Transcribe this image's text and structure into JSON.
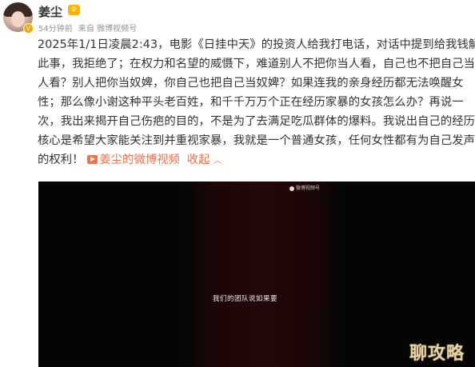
{
  "user": {
    "name": "姜尘",
    "vip_badge": "♔",
    "verified_mark": "V"
  },
  "meta": {
    "time": "54分钟前",
    "source": "来自 微博视频号"
  },
  "post": {
    "lines": [
      "2025年1/1日凌晨2:43，电影《日挂中天》的投资人给我打电话，对话中提到给我钱解决",
      "此事，我拒绝了；在权力和名望的威慑下，难道别人不把你当人看，自己也不把自己当",
      "人看？别人把你当奴婢，你自己也把自己当奴婢？如果连我的亲身经历都无法唤醒女",
      "性；那么像小谢这种平头老百姓，和千千万万个正在经历家暴的女孩怎么办？再说一",
      "次，我出来揭开自己伤疤的目的，不是为了去满足吃瓜群体的爆料。我说出自己的经历",
      "核心是希望大家能关注到并重视家暴，我就是一个普通女孩，任何女性都有为自己发声"
    ],
    "last_line_start": "的权利！",
    "video_link": "姜尘的微博视频",
    "collapse": "收起",
    "collapse_icon": "chevron-up"
  },
  "video": {
    "watermark": "微博视频号",
    "subtitle": "我们的团队说如果要"
  },
  "corner_watermark": "聊攻略"
}
